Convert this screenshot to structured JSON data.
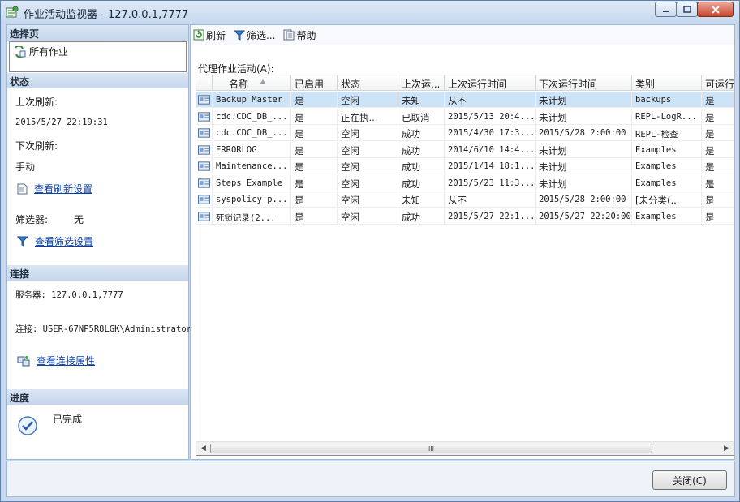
{
  "window": {
    "title": "作业活动监视器 - 127.0.0.1,7777"
  },
  "left": {
    "select_page_header": "选择页",
    "all_jobs": "所有作业",
    "status_header": "状态",
    "last_refresh_label": "上次刷新:",
    "last_refresh_value": "2015/5/27 22:19:31",
    "next_refresh_label": "下次刷新:",
    "next_refresh_value": "手动",
    "view_refresh_settings": "查看刷新设置",
    "filter_label": "筛选器:",
    "filter_value": "无",
    "view_filter_settings": "查看筛选设置",
    "connection_header": "连接",
    "server_line": "服务器: 127.0.0.1,7777",
    "connection_line": "连接: USER-67NP5R8LGK\\Administrator",
    "view_connection_properties": "查看连接属性",
    "progress_header": "进度",
    "progress_status": "已完成"
  },
  "toolbar": {
    "refresh": "刷新",
    "filter": "筛选...",
    "help": "帮助"
  },
  "grid": {
    "label": "代理作业活动(A):",
    "columns": [
      "名称",
      "已启用",
      "状态",
      "上次运...",
      "上次运行时间",
      "下次运行时间",
      "类别",
      "可运行"
    ],
    "rows": [
      {
        "name": "Backup Master",
        "enabled": "是",
        "status": "空闲",
        "last_outcome": "未知",
        "last_run": "从不",
        "next_run": "未计划",
        "category": "backups",
        "runnable": "是"
      },
      {
        "name": "cdc.CDC_DB_...",
        "enabled": "是",
        "status": "正在执...",
        "last_outcome": "已取消",
        "last_run": "2015/5/13 20:4...",
        "next_run": "未计划",
        "category": "REPL-LogR...",
        "runnable": "是"
      },
      {
        "name": "cdc.CDC_DB_...",
        "enabled": "是",
        "status": "空闲",
        "last_outcome": "成功",
        "last_run": "2015/4/30 17:3...",
        "next_run": "2015/5/28 2:00:00",
        "category": "REPL-检查",
        "runnable": "是"
      },
      {
        "name": "ERRORLOG",
        "enabled": "是",
        "status": "空闲",
        "last_outcome": "成功",
        "last_run": "2014/6/10 14:4...",
        "next_run": "未计划",
        "category": "Examples",
        "runnable": "是"
      },
      {
        "name": "Maintenance...",
        "enabled": "是",
        "status": "空闲",
        "last_outcome": "成功",
        "last_run": "2015/1/14 18:1...",
        "next_run": "未计划",
        "category": "Examples",
        "runnable": "是"
      },
      {
        "name": "Steps Example",
        "enabled": "是",
        "status": "空闲",
        "last_outcome": "成功",
        "last_run": "2015/5/23 11:3...",
        "next_run": "未计划",
        "category": "Examples",
        "runnable": "是"
      },
      {
        "name": "syspolicy_p...",
        "enabled": "是",
        "status": "空闲",
        "last_outcome": "未知",
        "last_run": "从不",
        "next_run": "2015/5/28 2:00:00",
        "category": "[未分类(...",
        "runnable": "是"
      },
      {
        "name": "死锁记录(2...",
        "enabled": "是",
        "status": "空闲",
        "last_outcome": "成功",
        "last_run": "2015/5/27 22:1...",
        "next_run": "2015/5/27 22:20:00",
        "category": "Examples",
        "runnable": "是"
      }
    ],
    "scroll_grip": "III"
  },
  "footer": {
    "close": "关闭(C)"
  },
  "colors": {
    "accent": "#cde3f8",
    "section_header": "#c5d6ec",
    "link": "#0b3fa8"
  }
}
